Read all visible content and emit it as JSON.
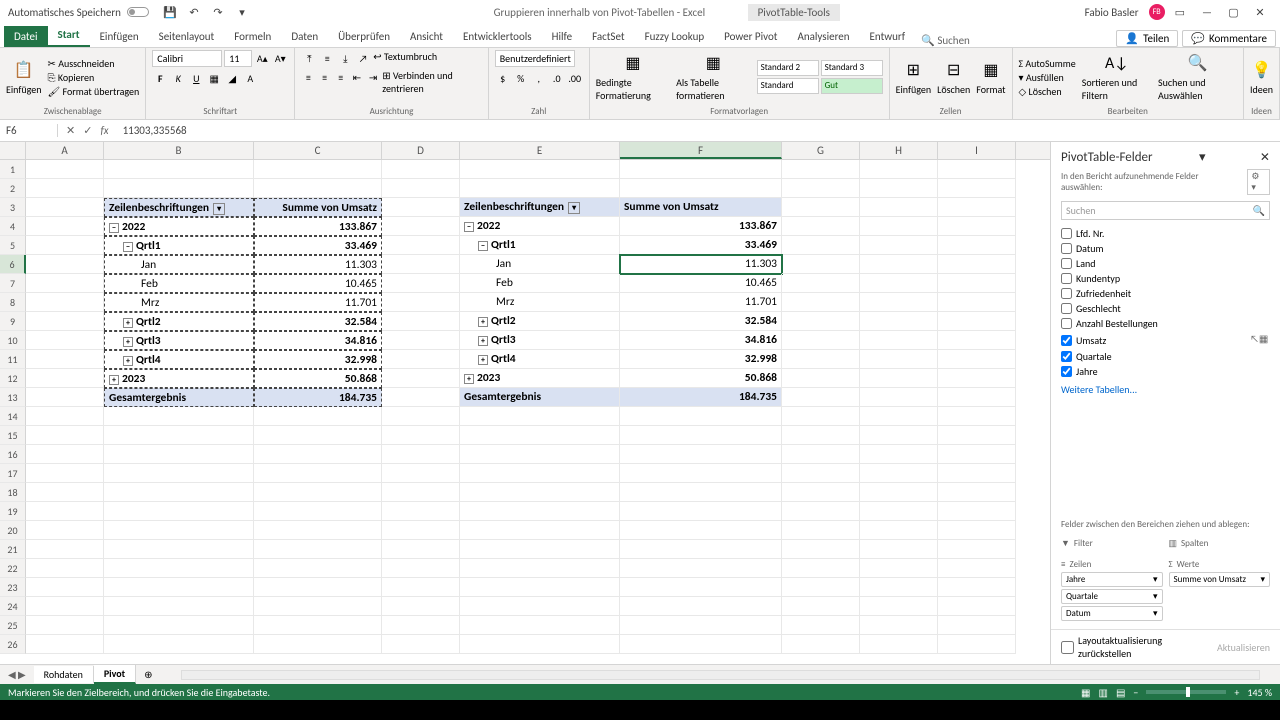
{
  "titlebar": {
    "autosave": "Automatisches Speichern",
    "doc_title": "Gruppieren innerhalb von Pivot-Tabellen  -  Excel",
    "context_tools": "PivotTable-Tools",
    "user": "Fabio Basler",
    "avatar": "FB"
  },
  "tabs": {
    "file": "Datei",
    "start": "Start",
    "insert": "Einfügen",
    "layout": "Seitenlayout",
    "formulas": "Formeln",
    "data": "Daten",
    "review": "Überprüfen",
    "view": "Ansicht",
    "dev": "Entwicklertools",
    "help": "Hilfe",
    "factset": "FactSet",
    "fuzzy": "Fuzzy Lookup",
    "powerpivot": "Power Pivot",
    "analyze": "Analysieren",
    "design": "Entwurf",
    "search": "Suchen",
    "share": "Teilen",
    "comments": "Kommentare"
  },
  "ribbon": {
    "paste": "Einfügen",
    "cut": "Ausschneiden",
    "copy": "Kopieren",
    "format_paint": "Format übertragen",
    "clipboard": "Zwischenablage",
    "font_name": "Calibri",
    "font_size": "11",
    "font": "Schriftart",
    "wrap": "Textumbruch",
    "merge": "Verbinden und zentrieren",
    "align": "Ausrichtung",
    "numfmt": "Benutzerdefiniert",
    "number": "Zahl",
    "cond": "Bedingte Formatierung",
    "astable": "Als Tabelle formatieren",
    "std2": "Standard 2",
    "std3": "Standard 3",
    "std": "Standard",
    "gut": "Gut",
    "styles": "Formatvorlagen",
    "insert_c": "Einfügen",
    "delete_c": "Löschen",
    "format_c": "Format",
    "cells": "Zellen",
    "autosum": "AutoSumme",
    "fill": "Ausfüllen",
    "clear": "Löschen",
    "sort": "Sortieren und Filtern",
    "find": "Suchen und Auswählen",
    "edit": "Bearbeiten",
    "ideas": "Ideen"
  },
  "formula_bar": {
    "name": "F6",
    "value": "11303,335568"
  },
  "columns": [
    "A",
    "B",
    "C",
    "D",
    "E",
    "F",
    "G",
    "H",
    "I"
  ],
  "pivot1": {
    "rowlabels": "Zeilenbeschriftungen",
    "sumcol": "Summe von Umsatz",
    "y2022": "2022",
    "v2022": "133.867",
    "q1": "Qrtl1",
    "vq1": "33.469",
    "jan": "Jan",
    "vjan": "11.303",
    "feb": "Feb",
    "vfeb": "10.465",
    "mrz": "Mrz",
    "vmrz": "11.701",
    "q2": "Qrtl2",
    "vq2": "32.584",
    "q3": "Qrtl3",
    "vq3": "34.816",
    "q4": "Qrtl4",
    "vq4": "32.998",
    "y2023": "2023",
    "v2023": "50.868",
    "total": "Gesamtergebnis",
    "vtotal": "184.735"
  },
  "pivot2": {
    "rowlabels": "Zeilenbeschriftungen",
    "sumcol": "Summe von Umsatz",
    "y2022": "2022",
    "v2022": "133.867",
    "q1": "Qrtl1",
    "vq1": "33.469",
    "jan": "Jan",
    "vjan": "11.303",
    "feb": "Feb",
    "vfeb": "10.465",
    "mrz": "Mrz",
    "vmrz": "11.701",
    "q2": "Qrtl2",
    "vq2": "32.584",
    "q3": "Qrtl3",
    "vq3": "34.816",
    "q4": "Qrtl4",
    "vq4": "32.998",
    "y2023": "2023",
    "v2023": "50.868",
    "total": "Gesamtergebnis",
    "vtotal": "184.735"
  },
  "pane": {
    "title": "PivotTable-Felder",
    "subtitle": "In den Bericht aufzunehmende Felder auswählen:",
    "search": "Suchen",
    "fields": {
      "lfdnr": "Lfd. Nr.",
      "datum": "Datum",
      "land": "Land",
      "kundentyp": "Kundentyp",
      "zufriedenheit": "Zufriedenheit",
      "geschlecht": "Geschlecht",
      "anzahl": "Anzahl Bestellungen",
      "umsatz": "Umsatz",
      "quartale": "Quartale",
      "jahre": "Jahre"
    },
    "moretables": "Weitere Tabellen...",
    "draghint": "Felder zwischen den Bereichen ziehen und ablegen:",
    "filter": "Filter",
    "columns": "Spalten",
    "rows": "Zeilen",
    "values": "Werte",
    "row_items": {
      "jahre": "Jahre",
      "quartale": "Quartale",
      "datum": "Datum"
    },
    "val_items": {
      "sum": "Summe von Umsatz"
    },
    "defer": "Layoutaktualisierung zurückstellen",
    "update": "Aktualisieren"
  },
  "sheets": {
    "rohdaten": "Rohdaten",
    "pivot": "Pivot"
  },
  "status": {
    "msg": "Markieren Sie den Zielbereich, und drücken Sie die Eingabetaste.",
    "zoom": "145 %"
  }
}
